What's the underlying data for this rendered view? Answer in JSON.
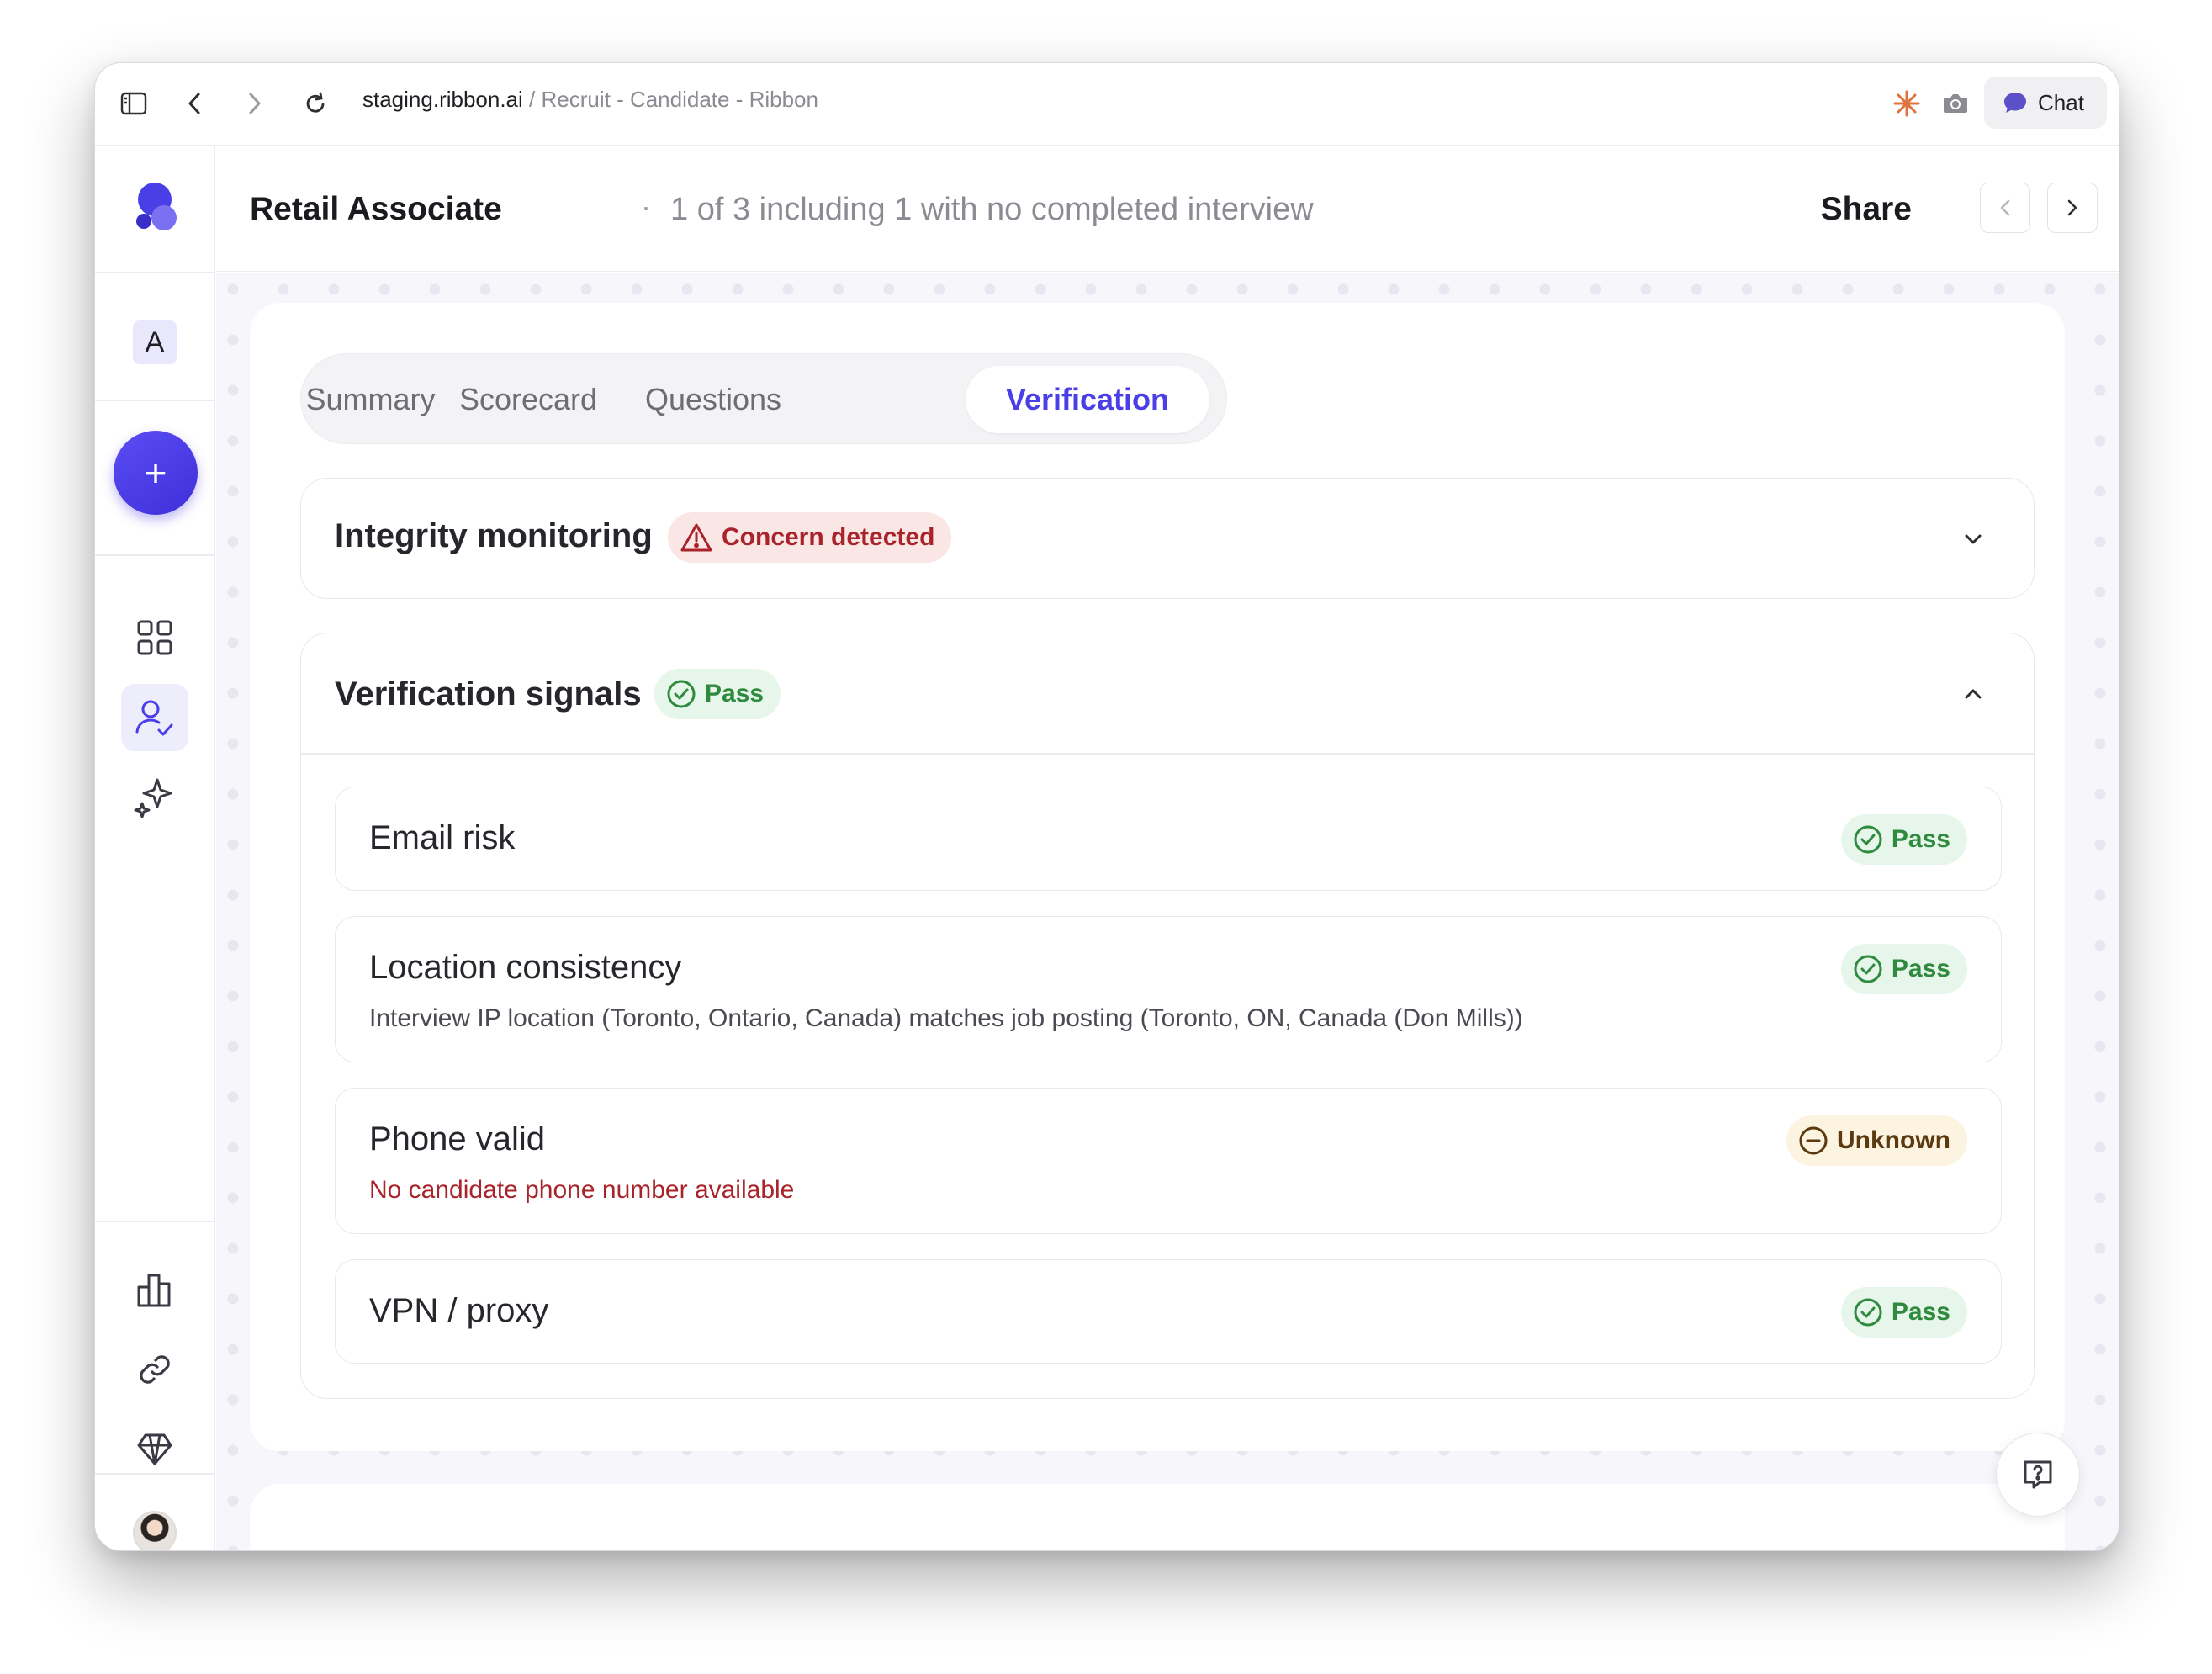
{
  "browser": {
    "url_host": "staging.ribbon.ai",
    "url_separator": " / ",
    "page_title": "Recruit - Candidate - Ribbon",
    "chat_label": "Chat"
  },
  "sidebar": {
    "workspace_initial": "A",
    "new_label": "+",
    "items": [
      {
        "name": "dashboard",
        "icon": "grid-icon",
        "active": false
      },
      {
        "name": "candidates",
        "icon": "user-check-icon",
        "active": true
      },
      {
        "name": "ai",
        "icon": "sparkles-icon",
        "active": false
      },
      {
        "name": "reports",
        "icon": "bar-chart-icon",
        "active": false
      },
      {
        "name": "integrations",
        "icon": "link-icon",
        "active": false
      },
      {
        "name": "plan",
        "icon": "diamond-icon",
        "active": false
      }
    ]
  },
  "header": {
    "title": "Retail Associate",
    "separator": "·",
    "subtitle": "1 of 3 including 1 with no completed interview",
    "share_label": "Share"
  },
  "tabs": [
    {
      "label": "Summary",
      "active": false
    },
    {
      "label": "Scorecard",
      "active": false
    },
    {
      "label": "Questions",
      "active": false
    },
    {
      "label": "Verification",
      "active": true
    }
  ],
  "integrity": {
    "title": "Integrity monitoring",
    "status": "Concern detected",
    "expanded": false
  },
  "verification": {
    "title": "Verification signals",
    "status": "Pass",
    "expanded": true,
    "items": [
      {
        "title": "Email risk",
        "description": "",
        "status": "Pass"
      },
      {
        "title": "Location consistency",
        "description": "Interview IP location (Toronto, Ontario, Canada) matches job posting (Toronto, ON, Canada (Don Mills))",
        "status": "Pass"
      },
      {
        "title": "Phone valid",
        "description": "No candidate phone number available",
        "status": "Unknown"
      },
      {
        "title": "VPN / proxy",
        "description": "",
        "status": "Pass"
      }
    ]
  },
  "colors": {
    "accent": "#4a3ee6",
    "pass": "#2f8a3e",
    "concern": "#a8232a",
    "unknown": "#5a3a0e"
  }
}
